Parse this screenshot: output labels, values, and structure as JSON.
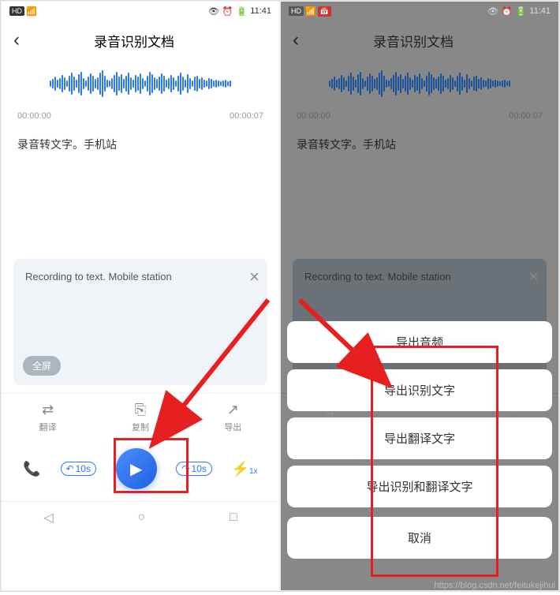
{
  "status_bar": {
    "hd": "HD",
    "signal": "4G",
    "time": "11:41",
    "battery": "88"
  },
  "header": {
    "title": "录音识别文档"
  },
  "timestamps": {
    "start": "00:00:00",
    "end": "00:00:07"
  },
  "transcription": {
    "text": "录音转文字。手机站"
  },
  "translation": {
    "text": "Recording to text. Mobile station",
    "fullscreen_label": "全屏"
  },
  "tabs": {
    "translate": "翻译",
    "copy": "复制",
    "export": "导出"
  },
  "playback": {
    "rewind": "10s",
    "forward": "10s",
    "speed": "1x"
  },
  "action_sheet": {
    "export_audio": "导出音频",
    "export_recognized": "导出识别文字",
    "export_translated": "导出翻译文字",
    "export_both": "导出识别和翻译文字",
    "cancel": "取消"
  },
  "watermark": "https://blog.csdn.net/feitukejihui"
}
